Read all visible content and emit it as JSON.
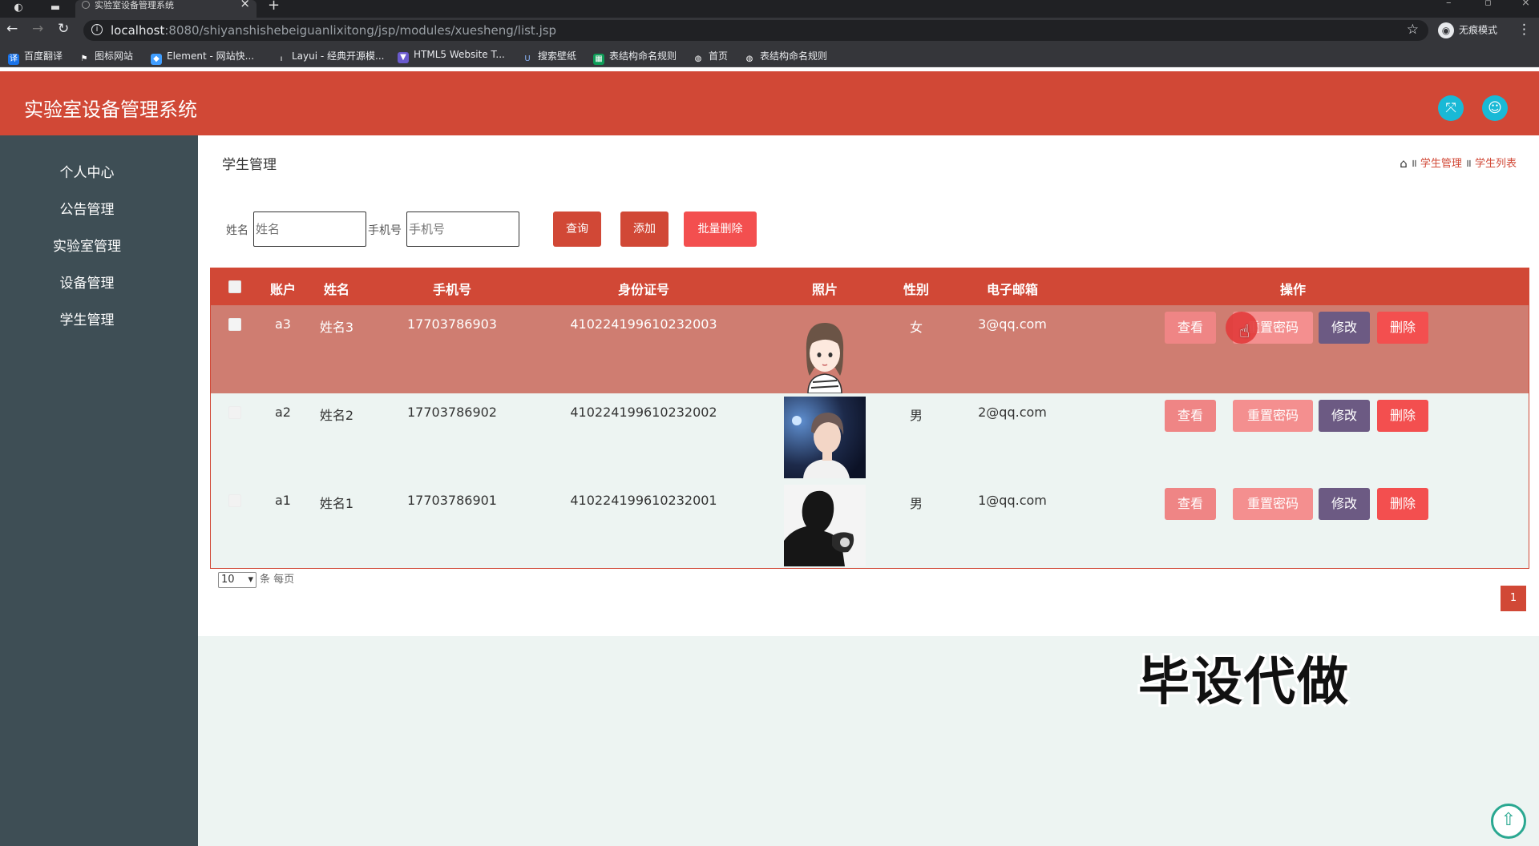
{
  "browser": {
    "tab_title": "实验室设备管理系统",
    "url_host": "localhost",
    "url_path": ":8080/shiyanshishebeiguanlixitong/jsp/modules/xuesheng/list.jsp",
    "profile_label": "无痕模式",
    "bookmarks": [
      {
        "label": "百度翻译",
        "icon": "translate-icon",
        "color": "#1a73e8"
      },
      {
        "label": "图标网站",
        "icon": "flag-icon",
        "color": "#35363a"
      },
      {
        "label": "Element - 网站快...",
        "icon": "element-icon",
        "color": "#409eff"
      },
      {
        "label": "Layui - 经典开源模...",
        "icon": "layui-icon",
        "color": "#35363a"
      },
      {
        "label": "HTML5 Website T...",
        "icon": "html5-icon",
        "color": "#6a5acd"
      },
      {
        "label": "搜索壁纸",
        "icon": "wallpaper-icon",
        "color": "#35363a"
      },
      {
        "label": "表结构命名规则",
        "icon": "sheet-icon",
        "color": "#0f9d58"
      },
      {
        "label": "首页",
        "icon": "globe-icon",
        "color": "#35363a"
      },
      {
        "label": "表结构命名规则",
        "icon": "globe-icon",
        "color": "#35363a"
      }
    ]
  },
  "header": {
    "title": "实验室设备管理系统",
    "colors": {
      "header_bg": "#d14836",
      "icon_btn": "#19b9d6"
    }
  },
  "sidebar": {
    "items": [
      {
        "label": "个人中心"
      },
      {
        "label": "公告管理"
      },
      {
        "label": "实验室管理"
      },
      {
        "label": "设备管理"
      },
      {
        "label": "学生管理"
      }
    ]
  },
  "main": {
    "page_title": "学生管理",
    "breadcrumb": {
      "sep": "॥",
      "items": [
        "学生管理",
        "学生列表"
      ]
    },
    "search": {
      "name_label": "姓名",
      "name_placeholder": "姓名",
      "phone_label": "手机号",
      "phone_placeholder": "手机号",
      "query_btn": "查询",
      "add_btn": "添加",
      "batch_delete_btn": "批量删除"
    },
    "table": {
      "columns": [
        "账户",
        "姓名",
        "手机号",
        "身份证号",
        "照片",
        "性别",
        "电子邮箱",
        "操作"
      ],
      "rows": [
        {
          "account": "a3",
          "name": "姓名3",
          "phone": "17703786903",
          "id_card": "410224199610232003",
          "photo": "cartoon-girl-avatar",
          "gender": "女",
          "email": "3@qq.com"
        },
        {
          "account": "a2",
          "name": "姓名2",
          "phone": "17703786902",
          "id_card": "410224199610232002",
          "photo": "young-man-portrait",
          "gender": "男",
          "email": "2@qq.com"
        },
        {
          "account": "a1",
          "name": "姓名1",
          "phone": "17703786901",
          "id_card": "410224199610232001",
          "photo": "silhouette-portrait",
          "gender": "男",
          "email": "1@qq.com"
        }
      ],
      "actions": {
        "view": "查看",
        "reset_pwd": "重置密码",
        "edit": "修改",
        "delete": "删除"
      }
    },
    "pagination": {
      "page_size": "10",
      "page_size_suffix": "条 每页",
      "current_page": "1"
    }
  },
  "watermark": "毕设代做"
}
